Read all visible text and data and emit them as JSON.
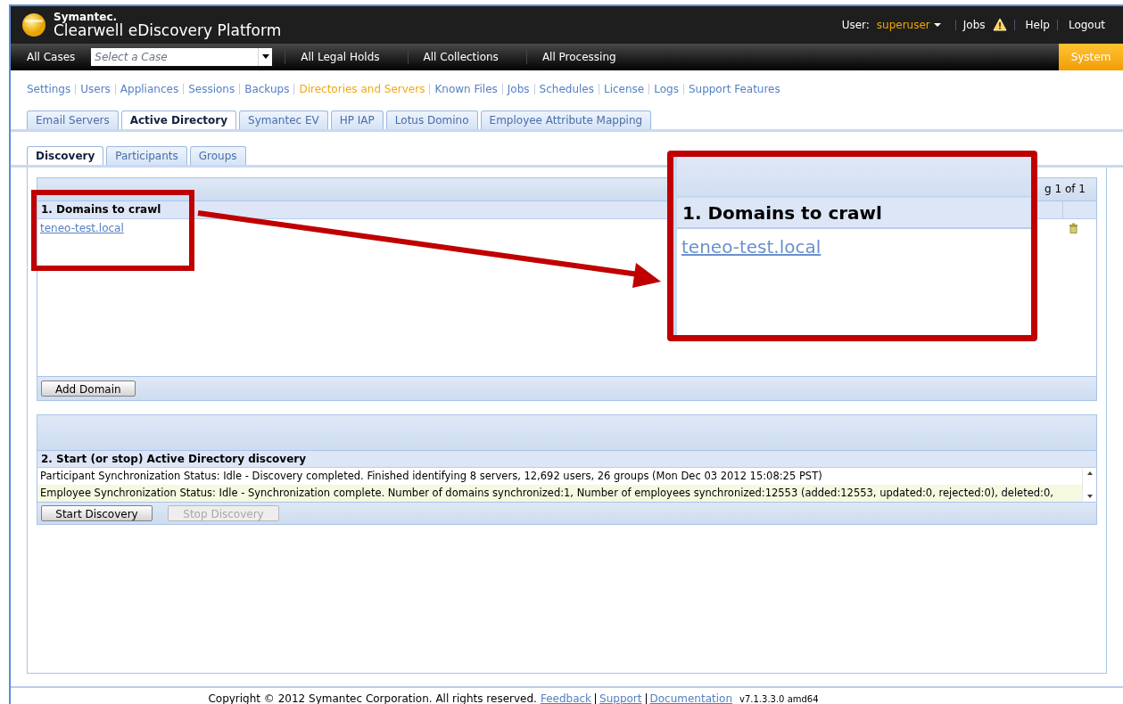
{
  "header": {
    "brand": "Symantec.",
    "product": "Clearwell eDiscovery Platform",
    "user_label": "User:",
    "user": "superuser",
    "jobs": "Jobs",
    "help": "Help",
    "logout": "Logout"
  },
  "nav": {
    "all_cases": "All Cases",
    "case_select": {
      "placeholder": "Select a Case"
    },
    "items": [
      "All Legal Holds",
      "All Collections",
      "All Processing"
    ],
    "system": "System"
  },
  "admin_links": [
    {
      "label": "Settings",
      "selected": false
    },
    {
      "label": "Users",
      "selected": false
    },
    {
      "label": "Appliances",
      "selected": false
    },
    {
      "label": "Sessions",
      "selected": false
    },
    {
      "label": "Backups",
      "selected": false
    },
    {
      "label": "Directories and Servers",
      "selected": true
    },
    {
      "label": "Known Files",
      "selected": false
    },
    {
      "label": "Jobs",
      "selected": false
    },
    {
      "label": "Schedules",
      "selected": false
    },
    {
      "label": "License",
      "selected": false
    },
    {
      "label": "Logs",
      "selected": false
    },
    {
      "label": "Support Features",
      "selected": false
    }
  ],
  "tabs": [
    {
      "label": "Email Servers",
      "selected": false
    },
    {
      "label": "Active Directory",
      "selected": true
    },
    {
      "label": "Symantec EV",
      "selected": false
    },
    {
      "label": "HP IAP",
      "selected": false
    },
    {
      "label": "Lotus Domino",
      "selected": false
    },
    {
      "label": "Employee Attribute Mapping",
      "selected": false
    }
  ],
  "subtabs": [
    {
      "label": "Discovery",
      "selected": true
    },
    {
      "label": "Participants",
      "selected": false
    },
    {
      "label": "Groups",
      "selected": false
    }
  ],
  "domains_panel": {
    "pager": "g 1 of 1",
    "heading": "1. Domains to crawl",
    "rows": [
      {
        "domain": "teneo-test.local"
      }
    ],
    "button": "Add Domain"
  },
  "discovery_panel": {
    "heading": "2. Start (or stop) Active Directory discovery",
    "status_lines": [
      "Participant Synchronization Status: Idle - Discovery completed. Finished identifying 8 servers, 12,692 users, 26 groups (Mon Dec 03 2012 15:08:25 PST)",
      "Employee Synchronization Status: Idle - Synchronization complete. Number of domains synchronized:1, Number of employees synchronized:12553 (added:12553, updated:0, rejected:0), deleted:0,"
    ],
    "buttons": [
      {
        "label": "Start Discovery",
        "disabled": false
      },
      {
        "label": "Stop Discovery",
        "disabled": true
      }
    ]
  },
  "callout": {
    "heading": "1. Domains to crawl",
    "link": "teneo-test.local"
  },
  "footer": {
    "copyright": "Copyright © 2012 Symantec Corporation. All rights reserved.",
    "links": [
      "Feedback",
      "Support",
      "Documentation"
    ],
    "version": "v7.1.3.3.0 amd64"
  }
}
